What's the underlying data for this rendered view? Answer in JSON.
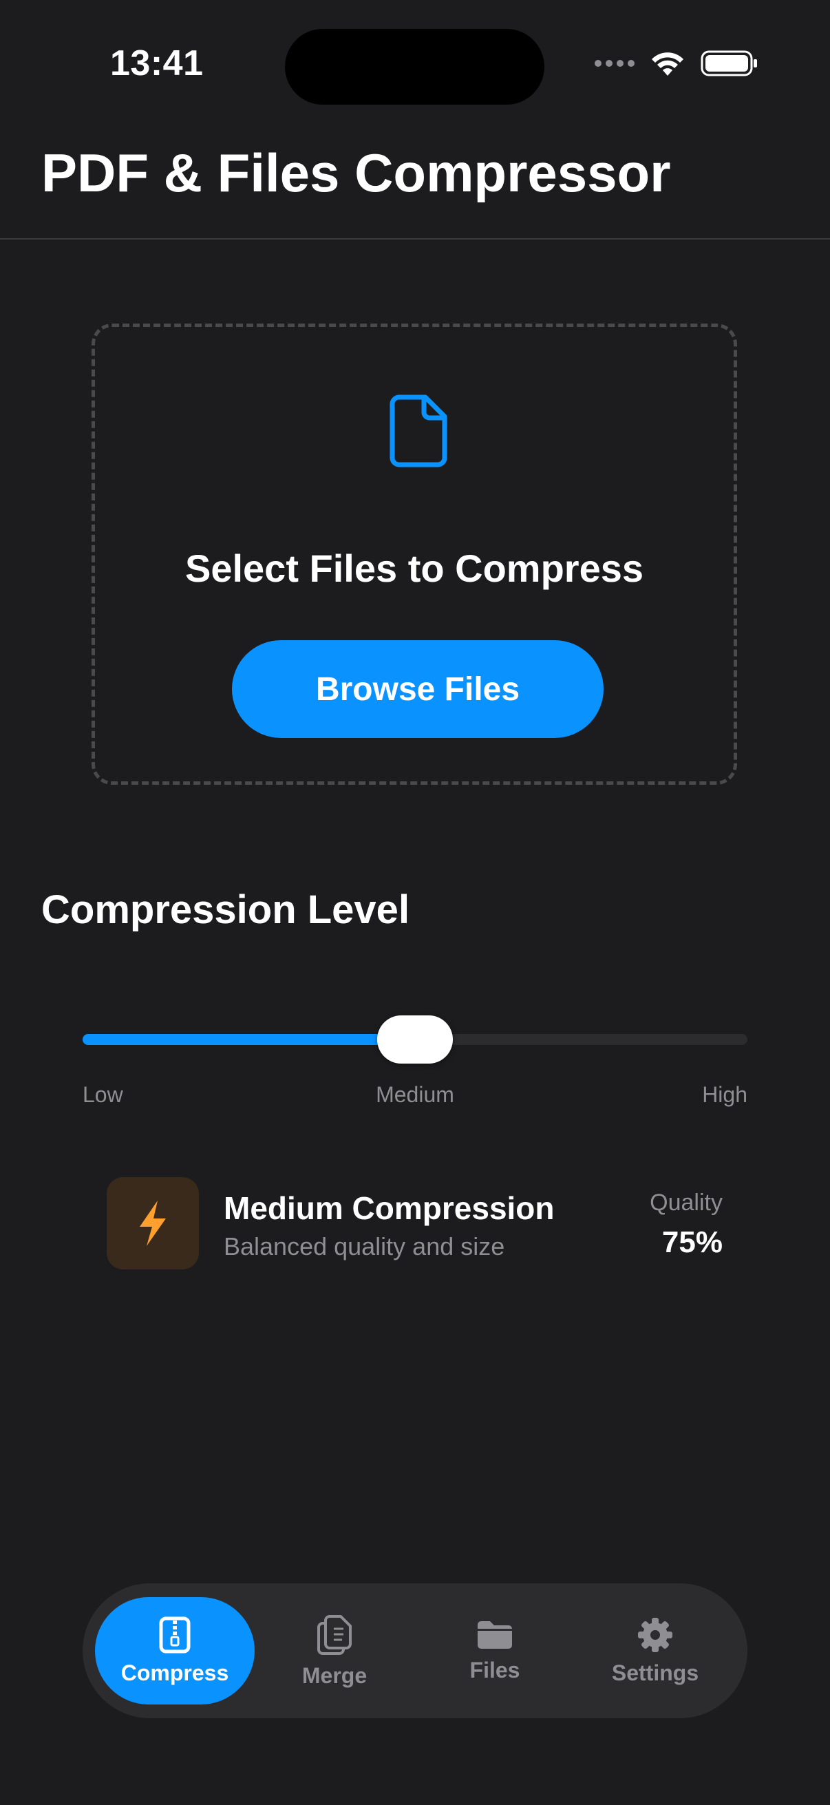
{
  "status_bar": {
    "time": "13:41"
  },
  "header": {
    "title": "PDF & Files Compressor"
  },
  "dropzone": {
    "icon": "document-icon",
    "title": "Select Files to Compress",
    "button_label": "Browse Files"
  },
  "compression": {
    "section_title": "Compression Level",
    "slider_value": 0.5,
    "labels": {
      "low": "Low",
      "medium": "Medium",
      "high": "High"
    },
    "level_icon": "bolt-icon",
    "level_name": "Medium Compression",
    "level_description": "Balanced quality and size",
    "quality_label": "Quality",
    "quality_value": "75%"
  },
  "tab_bar": {
    "tabs": [
      {
        "label": "Compress",
        "icon": "zip-file-icon",
        "active": true
      },
      {
        "label": "Merge",
        "icon": "merge-documents-icon",
        "active": false
      },
      {
        "label": "Files",
        "icon": "folder-icon",
        "active": false
      },
      {
        "label": "Settings",
        "icon": "gear-icon",
        "active": false
      }
    ]
  },
  "colors": {
    "background": "#1c1c1e",
    "accent": "#0a93ff",
    "bolt": "#ff9f2e",
    "secondary_text": "#8e8e93"
  }
}
